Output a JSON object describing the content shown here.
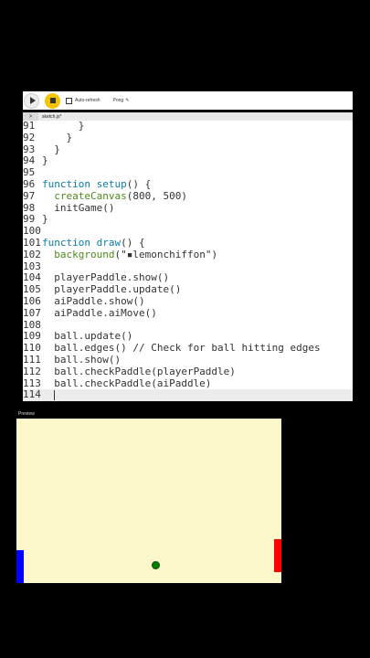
{
  "toolbar": {
    "auto_refresh_label": "Auto-refresh",
    "project_name": "Pong",
    "pencil_glyph": "✎"
  },
  "tabs": {
    "toggle_glyph": ">",
    "file_name": "sketch.js*"
  },
  "editor": {
    "lines": [
      {
        "n": "91",
        "code": "      }"
      },
      {
        "n": "92",
        "code": "    }"
      },
      {
        "n": "93",
        "code": "  }"
      },
      {
        "n": "94",
        "code": "}"
      },
      {
        "n": "95",
        "code": ""
      },
      {
        "n": "96",
        "code": "function setup() {"
      },
      {
        "n": "97",
        "code": "  createCanvas(800, 500)"
      },
      {
        "n": "98",
        "code": "  initGame()"
      },
      {
        "n": "99",
        "code": "}"
      },
      {
        "n": "100",
        "code": ""
      },
      {
        "n": "101",
        "code": "function draw() {"
      },
      {
        "n": "102",
        "code": "  background(\"▪lemonchiffon\")"
      },
      {
        "n": "103",
        "code": ""
      },
      {
        "n": "104",
        "code": "  playerPaddle.show()"
      },
      {
        "n": "105",
        "code": "  playerPaddle.update()"
      },
      {
        "n": "106",
        "code": "  aiPaddle.show()"
      },
      {
        "n": "107",
        "code": "  aiPaddle.aiMove()"
      },
      {
        "n": "108",
        "code": ""
      },
      {
        "n": "109",
        "code": "  ball.update()"
      },
      {
        "n": "110",
        "code": "  ball.edges() // Check for ball hitting edges"
      },
      {
        "n": "111",
        "code": "  ball.show()"
      },
      {
        "n": "112",
        "code": "  ball.checkPaddle(playerPaddle)"
      },
      {
        "n": "113",
        "code": "  ball.checkPaddle(aiPaddle)"
      },
      {
        "n": "114",
        "code": "  "
      }
    ]
  },
  "preview": {
    "label": "Preview",
    "background_color": "#fdf8cb",
    "left_paddle_color": "#0000ff",
    "right_paddle_color": "#ff0000",
    "ball_color": "#008000"
  },
  "colors": {
    "stop_button": "#f5c400",
    "keyword": "#0b7ca9"
  }
}
